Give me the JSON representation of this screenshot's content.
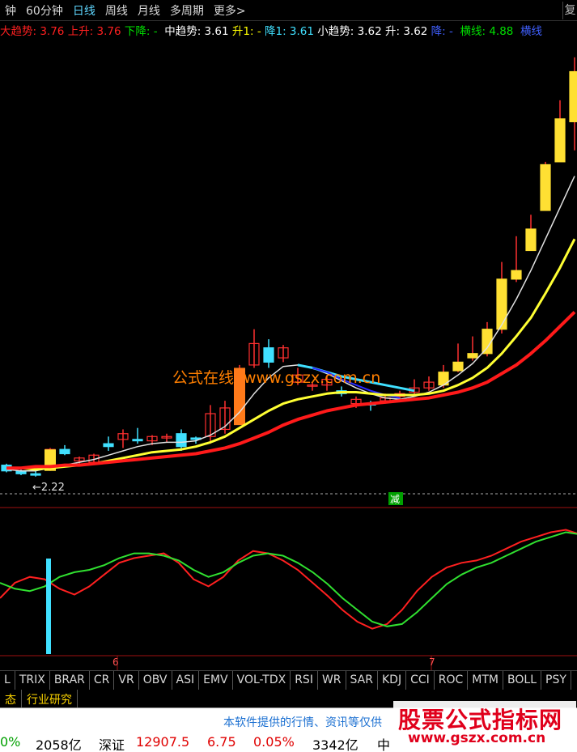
{
  "period_bar": {
    "tabs": [
      "钟",
      "60分钟",
      "日线",
      "周线",
      "月线",
      "多周期",
      "更多>"
    ],
    "active": "日线",
    "corner_char": "复"
  },
  "legend": [
    {
      "text": "大趋势: 3.76",
      "color": "#ff2020"
    },
    {
      "text": " 上升: 3.76",
      "color": "#ff2020"
    },
    {
      "text": " 下降: -",
      "color": "#00e000"
    },
    {
      "text": "  中趋势: 3.61",
      "color": "#ffffff"
    },
    {
      "text": " 升1: -",
      "color": "#ffff00"
    },
    {
      "text": " 降1: 3.61",
      "color": "#40e0ff"
    },
    {
      "text": " 小趋势: 3.62",
      "color": "#ffffff"
    },
    {
      "text": " 升: 3.62",
      "color": "#ffffff"
    },
    {
      "text": " 降: -",
      "color": "#4060ff"
    },
    {
      "text": "  横线: 4.88",
      "color": "#00e000"
    },
    {
      "text": "  横线",
      "color": "#4060ff"
    }
  ],
  "price_label": "←2.22",
  "flag_label": "减",
  "date_labels": [
    "6",
    "7"
  ],
  "watermark": {
    "cn": "公式在线",
    "url": "www.gszx.com.cn"
  },
  "indicator_tabs": [
    "L",
    "TRIX",
    "BRAR",
    "CR",
    "VR",
    "OBV",
    "ASI",
    "EMV",
    "VOL-TDX",
    "RSI",
    "WR",
    "SAR",
    "KDJ",
    "CCI",
    "ROC",
    "MTM",
    "BOLL",
    "PSY"
  ],
  "status_tabs": [
    "态",
    "行业研究"
  ],
  "notice": "本软件提供的行情、资讯等仅供",
  "ticker": [
    {
      "text": "0%",
      "color": "#00a000"
    },
    {
      "text": "2058亿",
      "color": "#000000"
    },
    {
      "text": "深证",
      "color": "#000000"
    },
    {
      "text": "12907.5",
      "color": "#e00000"
    },
    {
      "text": "6.75",
      "color": "#e00000"
    },
    {
      "text": "0.05%",
      "color": "#e00000"
    },
    {
      "text": "3342亿",
      "color": "#000000"
    },
    {
      "text": "中",
      "color": "#000000"
    }
  ],
  "logo": {
    "title": "股票公式指标网",
    "url": "www.gszx.com.cn"
  },
  "colors": {
    "up": "#ff3030",
    "down": "#40e0ff",
    "bg": "#000000",
    "ma_red": "#ff1a1a",
    "ma_yellow": "#ffff33",
    "ma_white": "#e0e0e0",
    "ma_cyan": "#40e0ff"
  },
  "chart_data": {
    "type": "candlestick",
    "candles": [
      {
        "o": 2.3,
        "h": 2.31,
        "l": 2.25,
        "c": 2.26
      },
      {
        "o": 2.26,
        "h": 2.28,
        "l": 2.23,
        "c": 2.24
      },
      {
        "o": 2.24,
        "h": 2.26,
        "l": 2.22,
        "c": 2.23
      },
      {
        "o": 2.27,
        "h": 2.42,
        "l": 2.26,
        "c": 2.41
      },
      {
        "o": 2.41,
        "h": 2.44,
        "l": 2.37,
        "c": 2.38
      },
      {
        "o": 2.33,
        "h": 2.36,
        "l": 2.3,
        "c": 2.35
      },
      {
        "o": 2.32,
        "h": 2.38,
        "l": 2.31,
        "c": 2.37
      },
      {
        "o": 2.45,
        "h": 2.5,
        "l": 2.4,
        "c": 2.43
      },
      {
        "o": 2.48,
        "h": 2.55,
        "l": 2.42,
        "c": 2.52
      },
      {
        "o": 2.48,
        "h": 2.56,
        "l": 2.45,
        "c": 2.47
      },
      {
        "o": 2.47,
        "h": 2.51,
        "l": 2.44,
        "c": 2.5
      },
      {
        "o": 2.49,
        "h": 2.52,
        "l": 2.46,
        "c": 2.5
      },
      {
        "o": 2.52,
        "h": 2.55,
        "l": 2.4,
        "c": 2.43
      },
      {
        "o": 2.49,
        "h": 2.5,
        "l": 2.45,
        "c": 2.48
      },
      {
        "o": 2.5,
        "h": 2.72,
        "l": 2.45,
        "c": 2.66
      },
      {
        "o": 2.55,
        "h": 2.75,
        "l": 2.52,
        "c": 2.7
      },
      {
        "o": 2.6,
        "h": 3.0,
        "l": 2.6,
        "c": 2.96
      },
      {
        "o": 3.0,
        "h": 3.25,
        "l": 2.98,
        "c": 3.15
      },
      {
        "o": 3.12,
        "h": 3.18,
        "l": 2.98,
        "c": 3.02
      },
      {
        "o": 3.05,
        "h": 3.14,
        "l": 3.02,
        "c": 3.12
      },
      {
        "o": 2.88,
        "h": 2.98,
        "l": 2.86,
        "c": 2.93
      },
      {
        "o": 2.86,
        "h": 2.88,
        "l": 2.82,
        "c": 2.86
      },
      {
        "o": 2.86,
        "h": 2.93,
        "l": 2.82,
        "c": 2.9
      },
      {
        "o": 2.82,
        "h": 2.85,
        "l": 2.78,
        "c": 2.8
      },
      {
        "o": 2.73,
        "h": 2.78,
        "l": 2.7,
        "c": 2.76
      },
      {
        "o": 2.73,
        "h": 2.75,
        "l": 2.68,
        "c": 2.72
      },
      {
        "o": 2.75,
        "h": 2.8,
        "l": 2.73,
        "c": 2.77
      },
      {
        "o": 2.78,
        "h": 2.82,
        "l": 2.75,
        "c": 2.8
      },
      {
        "o": 2.81,
        "h": 2.9,
        "l": 2.79,
        "c": 2.84
      },
      {
        "o": 2.84,
        "h": 2.92,
        "l": 2.82,
        "c": 2.88
      },
      {
        "o": 2.86,
        "h": 3.0,
        "l": 2.84,
        "c": 2.95
      },
      {
        "o": 2.96,
        "h": 3.15,
        "l": 2.95,
        "c": 3.02
      },
      {
        "o": 3.05,
        "h": 3.2,
        "l": 3.03,
        "c": 3.08
      },
      {
        "o": 3.08,
        "h": 3.3,
        "l": 3.06,
        "c": 3.25
      },
      {
        "o": 3.25,
        "h": 3.72,
        "l": 3.22,
        "c": 3.6
      },
      {
        "o": 3.6,
        "h": 3.9,
        "l": 3.58,
        "c": 3.66
      },
      {
        "o": 3.8,
        "h": 4.05,
        "l": 3.8,
        "c": 3.95
      },
      {
        "o": 4.08,
        "h": 4.42,
        "l": 4.08,
        "c": 4.4
      },
      {
        "o": 4.42,
        "h": 4.85,
        "l": 4.45,
        "c": 4.72
      },
      {
        "o": 4.7,
        "h": 5.15,
        "l": 4.5,
        "c": 5.05
      }
    ],
    "ma_red": [
      2.28,
      2.28,
      2.29,
      2.29,
      2.3,
      2.3,
      2.31,
      2.32,
      2.33,
      2.34,
      2.35,
      2.36,
      2.37,
      2.38,
      2.4,
      2.42,
      2.45,
      2.49,
      2.53,
      2.58,
      2.62,
      2.65,
      2.68,
      2.7,
      2.72,
      2.73,
      2.74,
      2.75,
      2.76,
      2.77,
      2.79,
      2.81,
      2.84,
      2.88,
      2.94,
      3.0,
      3.08,
      3.17,
      3.27,
      3.37
    ],
    "ma_yellow": [
      2.28,
      2.28,
      2.27,
      2.28,
      2.29,
      2.3,
      2.31,
      2.33,
      2.35,
      2.37,
      2.39,
      2.4,
      2.41,
      2.43,
      2.46,
      2.5,
      2.56,
      2.62,
      2.68,
      2.73,
      2.76,
      2.78,
      2.8,
      2.81,
      2.81,
      2.8,
      2.79,
      2.79,
      2.79,
      2.8,
      2.82,
      2.86,
      2.91,
      2.98,
      3.08,
      3.2,
      3.33,
      3.5,
      3.68,
      3.88
    ],
    "ma_white": [
      2.27,
      2.26,
      2.26,
      2.28,
      2.3,
      2.32,
      2.34,
      2.37,
      2.4,
      2.43,
      2.45,
      2.46,
      2.46,
      2.47,
      2.51,
      2.57,
      2.67,
      2.8,
      2.91,
      2.99,
      3.0,
      2.98,
      2.94,
      2.89,
      2.84,
      2.8,
      2.77,
      2.76,
      2.78,
      2.81,
      2.86,
      2.93,
      3.01,
      3.12,
      3.28,
      3.46,
      3.66,
      3.88,
      4.1,
      4.32
    ],
    "ma_cyan_segment": {
      "start": 20,
      "values": [
        3.0,
        2.98,
        2.95,
        2.92,
        2.9,
        2.88,
        2.86,
        2.84,
        2.82
      ]
    },
    "ma_blue_segment": {
      "start": 21,
      "values": [
        2.98,
        2.95,
        2.9,
        2.86,
        2.82,
        2.79,
        2.77
      ]
    },
    "ylim": [
      2.1,
      5.2
    ],
    "dashed_level": 2.1,
    "osc_red": [
      42,
      55,
      60,
      58,
      50,
      45,
      52,
      62,
      72,
      76,
      78,
      80,
      72,
      58,
      52,
      60,
      74,
      82,
      80,
      74,
      66,
      55,
      44,
      32,
      22,
      16,
      20,
      32,
      48,
      60,
      68,
      72,
      74,
      78,
      84,
      90,
      94,
      98,
      100,
      96
    ],
    "osc_green": [
      55,
      50,
      48,
      52,
      60,
      64,
      66,
      70,
      76,
      80,
      80,
      78,
      74,
      66,
      60,
      64,
      72,
      78,
      80,
      78,
      72,
      64,
      54,
      42,
      32,
      22,
      18,
      20,
      30,
      42,
      54,
      62,
      68,
      72,
      78,
      84,
      90,
      94,
      98,
      96
    ],
    "osc_ylim": [
      0,
      110
    ]
  }
}
